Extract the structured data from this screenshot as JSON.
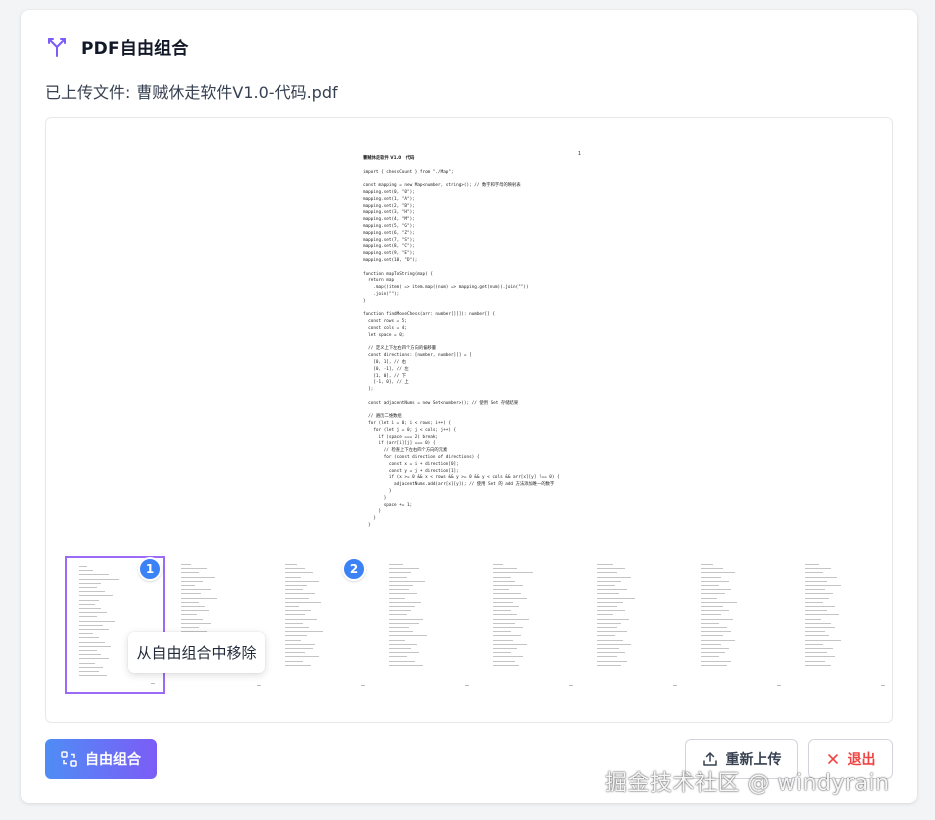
{
  "header": {
    "title": "PDF自由组合",
    "icon": "merge-icon"
  },
  "uploaded": {
    "label": "已上传文件:",
    "filename": "曹贼休走软件V1.0-代码.pdf"
  },
  "preview": {
    "page_number": "1",
    "lines": [
      {
        "text": "曹贼休走软件 V1.0   代码",
        "heading": true
      },
      {
        "text": ""
      },
      {
        "text": "import { chessCount } from \"./Map\";"
      },
      {
        "text": ""
      },
      {
        "text": "const mapping = new Map<number, string>(); // 数字和字母的映射表"
      },
      {
        "text": "mapping.set(0, \"0\");"
      },
      {
        "text": "mapping.set(1, \"A\");"
      },
      {
        "text": "mapping.set(2, \"B\");"
      },
      {
        "text": "mapping.set(3, \"H\");"
      },
      {
        "text": "mapping.set(4, \"M\");"
      },
      {
        "text": "mapping.set(5, \"G\");"
      },
      {
        "text": "mapping.set(6, \"Z\");"
      },
      {
        "text": "mapping.set(7, \"S\");"
      },
      {
        "text": "mapping.set(8, \"C\");"
      },
      {
        "text": "mapping.set(9, \"E\");"
      },
      {
        "text": "mapping.set(10, \"D\");"
      },
      {
        "text": ""
      },
      {
        "text": "function mapToString(map) {"
      },
      {
        "text": "  return map"
      },
      {
        "text": "    .map((item) => item.map((num) => mapping.get(num)).join(\"\"))"
      },
      {
        "text": "    .join(\"\");"
      },
      {
        "text": "}"
      },
      {
        "text": ""
      },
      {
        "text": "function findMoveChess(arr: number[][]): number[] {"
      },
      {
        "text": "  const rows = 5;"
      },
      {
        "text": "  const cols = 4;"
      },
      {
        "text": "  let space = 0;"
      },
      {
        "text": ""
      },
      {
        "text": "  // 定义上下左右四个方向的偏移量"
      },
      {
        "text": "  const directions: [number, number][] = ["
      },
      {
        "text": "    [0, 1], // 右"
      },
      {
        "text": "    [0, -1], // 左"
      },
      {
        "text": "    [1, 0], // 下"
      },
      {
        "text": "    [-1, 0], // 上"
      },
      {
        "text": "  ];"
      },
      {
        "text": ""
      },
      {
        "text": "  const adjacentNums = new Set<number>(); // 使用 Set 存储结果"
      },
      {
        "text": ""
      },
      {
        "text": "  // 遍历二维数组"
      },
      {
        "text": "  for (let i = 0; i < rows; i++) {"
      },
      {
        "text": "    for (let j = 0; j < cols; j++) {"
      },
      {
        "text": "      if (space === 2) break;"
      },
      {
        "text": "      if (arr[i][j] === 0) {"
      },
      {
        "text": "        // 检查上下左右四个方向的元素"
      },
      {
        "text": "        for (const direction of directions) {"
      },
      {
        "text": "          const x = i + direction[0];"
      },
      {
        "text": "          const y = j + direction[1];"
      },
      {
        "text": "          if (x >= 0 && x < rows && y >= 0 && y < cols && arr[x][y] !== 0) {"
      },
      {
        "text": "            adjacentNums.add(arr[x][y]); // 使用 Set 的 add 方法添加唯一的数字"
      },
      {
        "text": "          }"
      },
      {
        "text": "        }"
      },
      {
        "text": "        space += 1;"
      },
      {
        "text": "      }"
      },
      {
        "text": "    }"
      },
      {
        "text": "  }"
      }
    ]
  },
  "thumbnails": {
    "badges": [
      {
        "label": "1"
      },
      {
        "label": "2"
      }
    ],
    "tooltip": "从自由组合中移除"
  },
  "actions": {
    "combine": {
      "label": "自由组合",
      "icon": "combine-icon"
    },
    "reupload": {
      "label": "重新上传",
      "icon": "upload-icon"
    },
    "exit": {
      "label": "退出",
      "icon": "close-icon"
    }
  },
  "watermark": "掘金技术社区 @ windyrain",
  "colors": {
    "accent_blue": "#3b82f6",
    "accent_purple": "#9b6bf7",
    "danger": "#ef4444"
  }
}
